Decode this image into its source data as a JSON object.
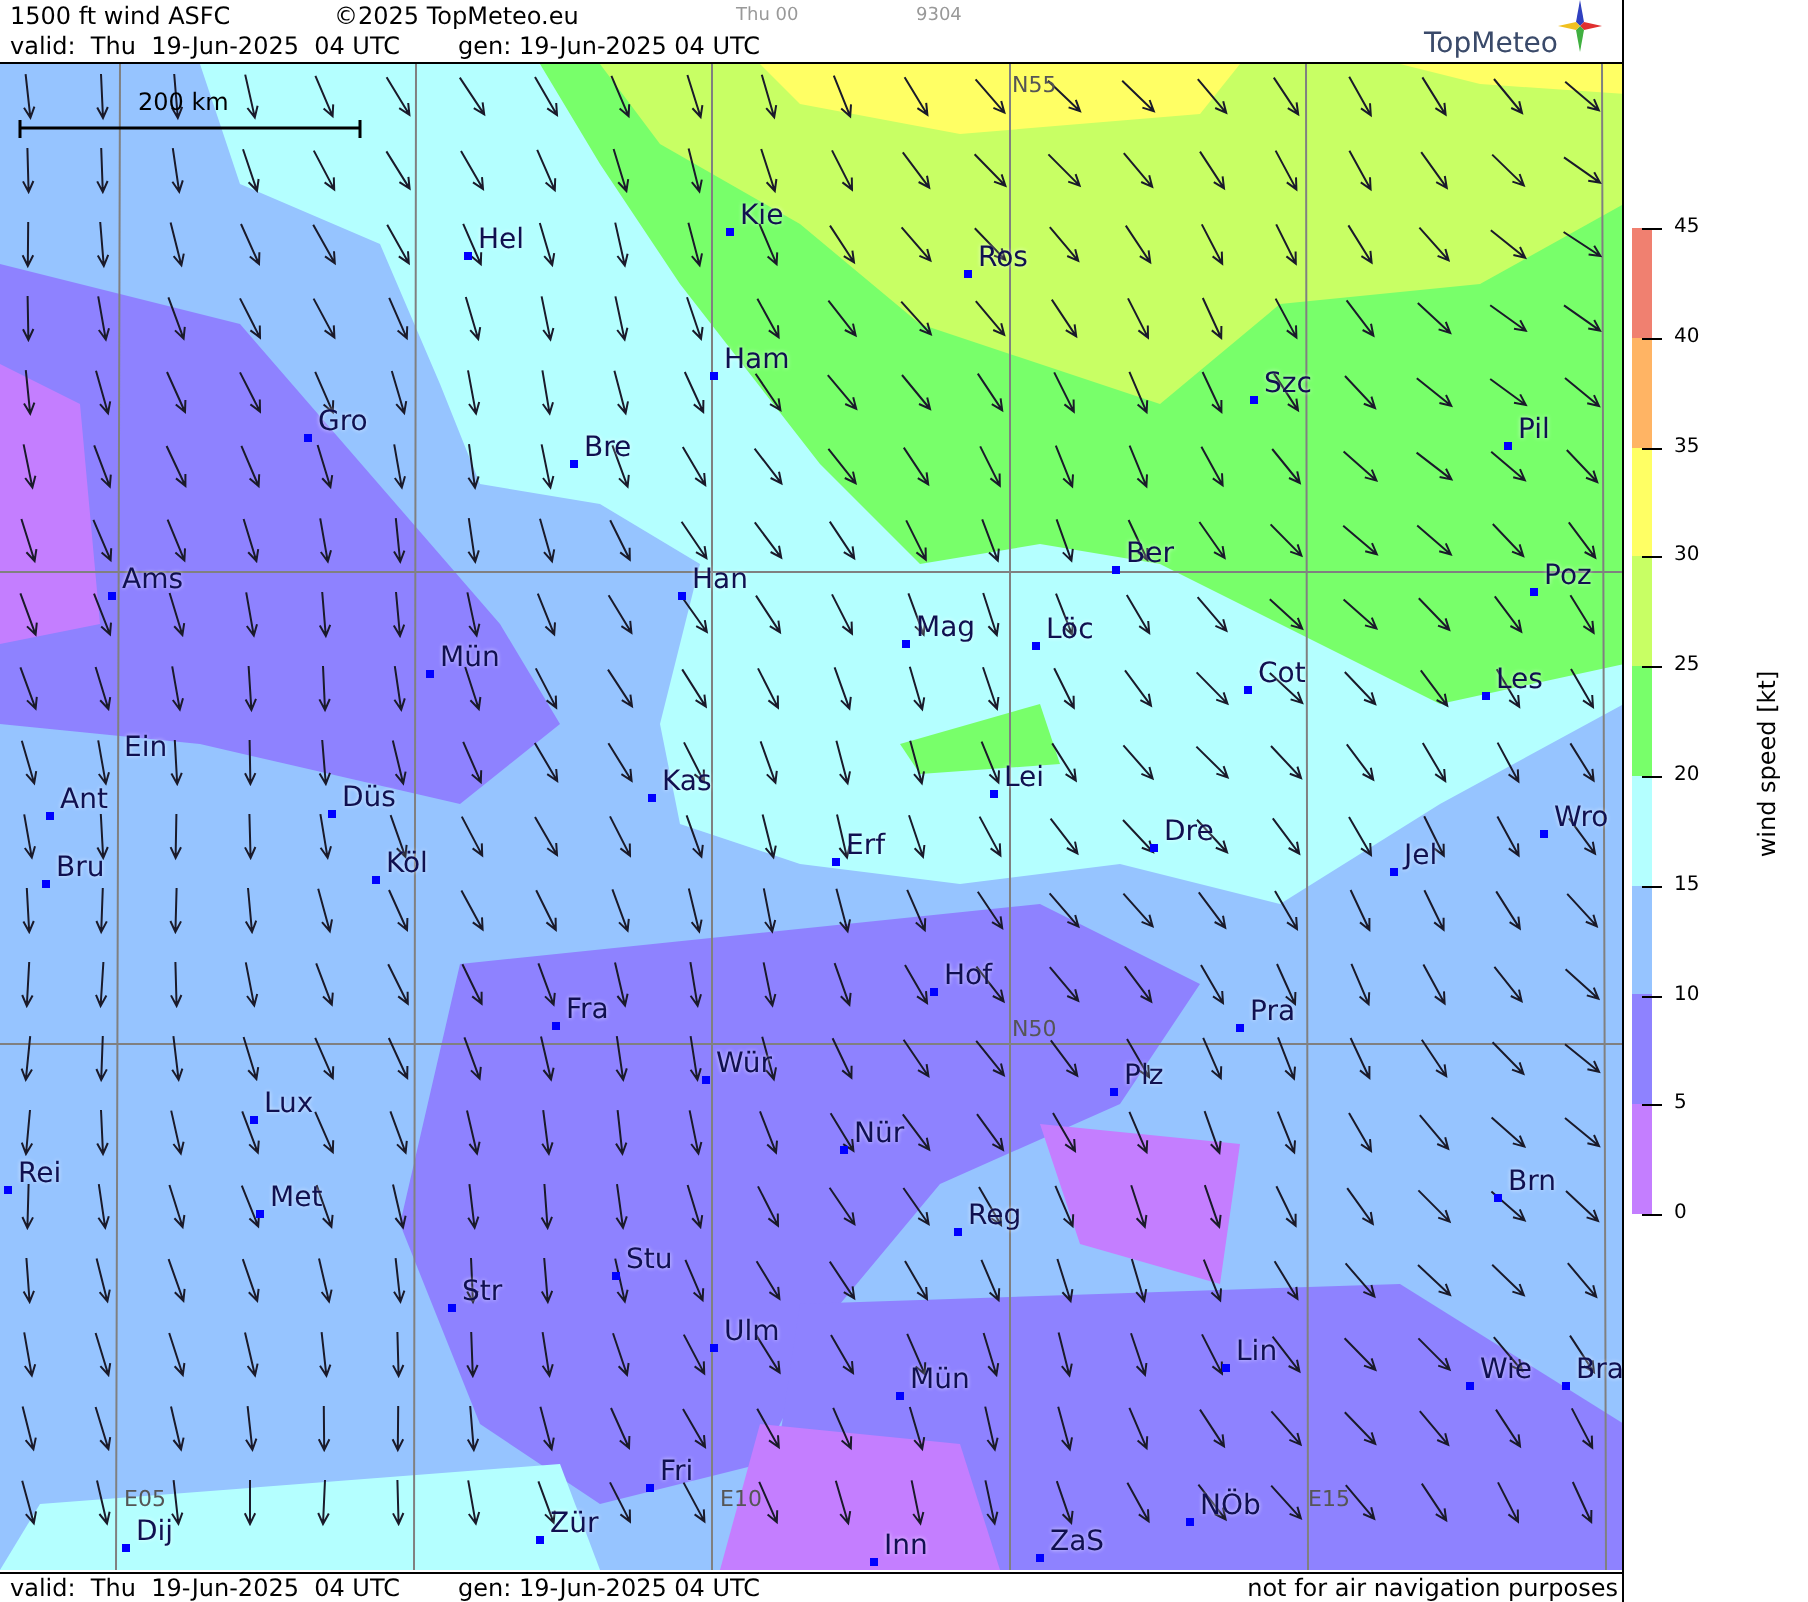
{
  "header": {
    "product": "1500 ft wind ASFC",
    "copyright": "©2025 TopMeteo.eu",
    "run": "Thu 00",
    "code": "9304",
    "valid": "valid:  Thu  19-Jun-2025  04 UTC",
    "generated": "gen: 19-Jun-2025 04 UTC",
    "logo": "TopMeteo"
  },
  "map": {
    "scale": "200 km",
    "grid_labels": [
      "N55",
      "N50",
      "E05",
      "E10",
      "E15"
    ],
    "cities": [
      {
        "name": "Hel",
        "marker": true
      },
      {
        "name": "Kie",
        "marker": true
      },
      {
        "name": "Ros",
        "marker": true
      },
      {
        "name": "Ham",
        "marker": true
      },
      {
        "name": "Szc",
        "marker": true
      },
      {
        "name": "Gro",
        "marker": true
      },
      {
        "name": "Bre",
        "marker": true
      },
      {
        "name": "Pil",
        "marker": true
      },
      {
        "name": "Ams",
        "marker": true
      },
      {
        "name": "Han",
        "marker": true
      },
      {
        "name": "Ber",
        "marker": true
      },
      {
        "name": "Poz",
        "marker": true
      },
      {
        "name": "Mün",
        "marker": true
      },
      {
        "name": "Mag",
        "marker": true
      },
      {
        "name": "Löc",
        "marker": true
      },
      {
        "name": "Cot",
        "marker": true
      },
      {
        "name": "Les",
        "marker": true
      },
      {
        "name": "Ein",
        "marker": false
      },
      {
        "name": "Ant",
        "marker": true
      },
      {
        "name": "Düs",
        "marker": true
      },
      {
        "name": "Kas",
        "marker": true
      },
      {
        "name": "Lei",
        "marker": true
      },
      {
        "name": "Dre",
        "marker": true
      },
      {
        "name": "Wro",
        "marker": true
      },
      {
        "name": "Bru",
        "marker": true
      },
      {
        "name": "Köl",
        "marker": true
      },
      {
        "name": "Erf",
        "marker": true
      },
      {
        "name": "Jel",
        "marker": true
      },
      {
        "name": "Hof",
        "marker": true
      },
      {
        "name": "Fra",
        "marker": true
      },
      {
        "name": "Pra",
        "marker": true
      },
      {
        "name": "Wür",
        "marker": true
      },
      {
        "name": "Lux",
        "marker": true
      },
      {
        "name": "Plz",
        "marker": true
      },
      {
        "name": "Nür",
        "marker": true
      },
      {
        "name": "Rei",
        "marker": true
      },
      {
        "name": "Met",
        "marker": true
      },
      {
        "name": "Reg",
        "marker": true
      },
      {
        "name": "Brn",
        "marker": true
      },
      {
        "name": "Stu",
        "marker": true
      },
      {
        "name": "Str",
        "marker": true
      },
      {
        "name": "Ulm",
        "marker": true
      },
      {
        "name": "Mün",
        "marker": true
      },
      {
        "name": "Lin",
        "marker": true
      },
      {
        "name": "Wie",
        "marker": true
      },
      {
        "name": "Bra",
        "marker": true
      },
      {
        "name": "Fri",
        "marker": true
      },
      {
        "name": "Dij",
        "marker": true
      },
      {
        "name": "Zür",
        "marker": true
      },
      {
        "name": "Inn",
        "marker": true
      },
      {
        "name": "ZaS",
        "marker": true
      },
      {
        "name": "NÖb",
        "marker": true
      }
    ]
  },
  "legend": {
    "title": "wind speed [kt]",
    "ticks": [
      "45",
      "40",
      "35",
      "30",
      "25",
      "20",
      "15",
      "10",
      "5",
      "0"
    ],
    "bands": [
      {
        "color": "#f08070"
      },
      {
        "color": "#ffb464"
      },
      {
        "color": "#ffff64"
      },
      {
        "color": "#c8ff64"
      },
      {
        "color": "#78ff6a"
      },
      {
        "color": "#b4ffff"
      },
      {
        "color": "#96c4ff"
      },
      {
        "color": "#8e82ff"
      },
      {
        "color": "#c47eff"
      }
    ]
  },
  "footer": {
    "valid": "valid:  Thu  19-Jun-2025  04 UTC",
    "generated": "gen: 19-Jun-2025 04 UTC",
    "note": "not for air navigation purposes"
  }
}
